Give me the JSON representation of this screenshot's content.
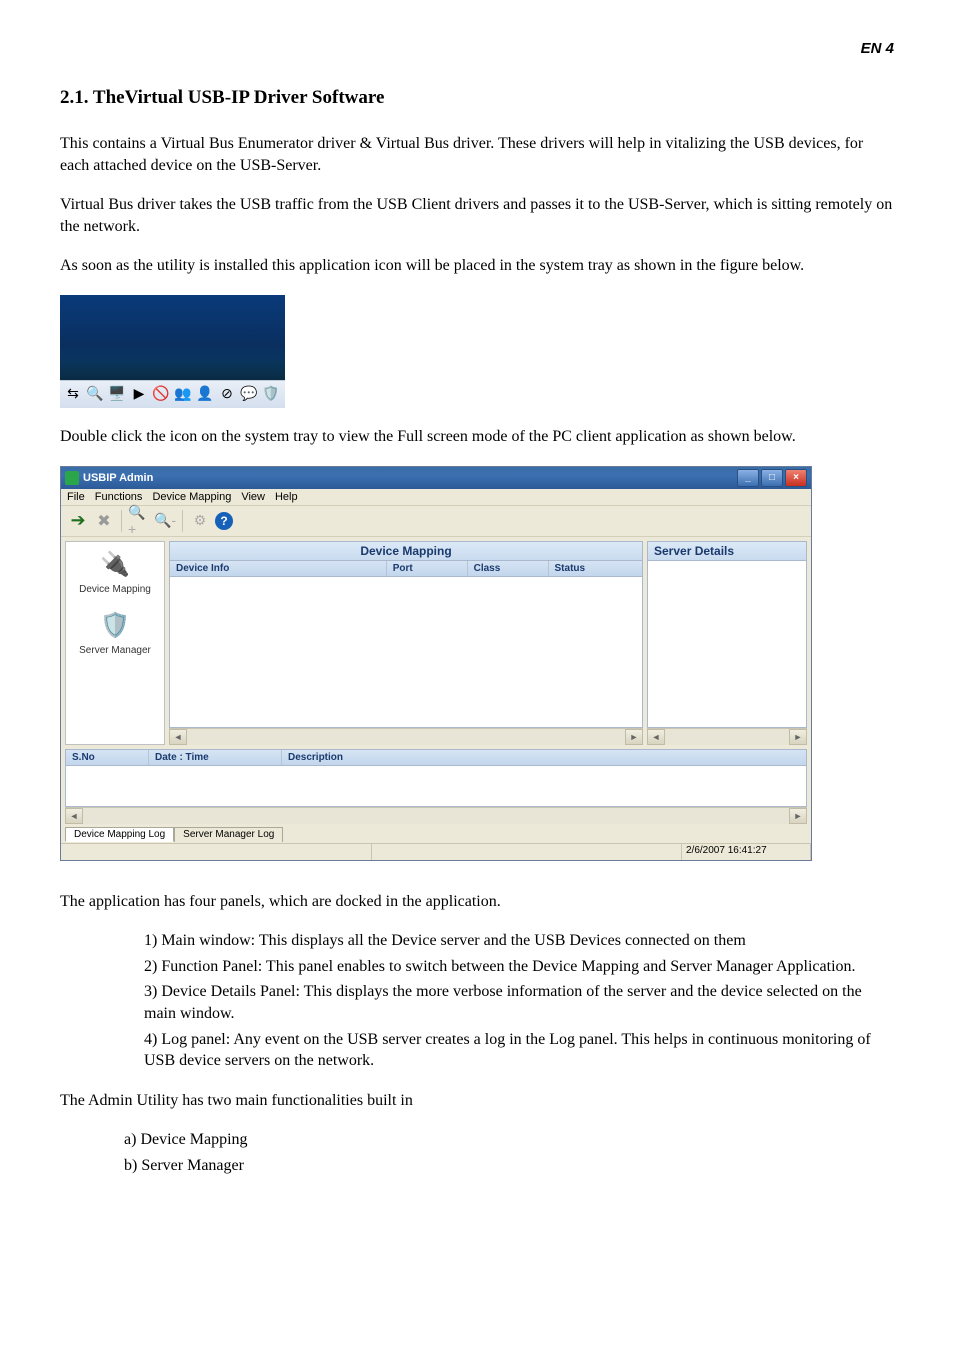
{
  "page_header": "EN 4",
  "heading": "2.1. TheVirtual USB-IP Driver Software",
  "para1": "This contains a Virtual Bus Enumerator driver & Virtual Bus driver. These drivers will help in vitalizing the USB devices, for each attached device on the USB-Server.",
  "para2": "Virtual Bus driver takes the USB traffic from the USB Client drivers and passes it to the USB-Server, which is sitting remotely on the network.",
  "para3": "As soon as the utility is installed this application icon will be placed in the system tray as shown in the figure below.",
  "para4": "Double click the icon on the system tray to view the Full screen mode of the PC client application as shown below.",
  "para5": "The application has four panels, which are docked in the application.",
  "panels_list": [
    "Main window: This displays all the Device server and the USB Devices connected on them",
    "Function Panel: This panel enables to switch between the Device Mapping and Server Manager Application.",
    "Device Details Panel: This displays the more verbose information of the server and the device selected on the main window.",
    "Log panel: Any event on the USB server creates a log in the Log panel. This helps in continuous monitoring of USB device servers on the network."
  ],
  "para6": "The Admin Utility has two main functionalities built in",
  "func_list": [
    "Device Mapping",
    "Server Manager"
  ],
  "appwin": {
    "title": "USBIP Admin",
    "menu": [
      "File",
      "Functions",
      "Device Mapping",
      "View",
      "Help"
    ],
    "toolbar": {
      "help": "?"
    },
    "func_panel": {
      "items": [
        {
          "label": "Device Mapping",
          "icon": "🔌"
        },
        {
          "label": "Server Manager",
          "icon": "🛡️"
        }
      ]
    },
    "device_mapping": {
      "title": "Device Mapping",
      "cols": [
        "Device Info",
        "Port",
        "Class",
        "Status"
      ]
    },
    "server_details": {
      "title": "Server Details"
    },
    "log": {
      "cols": [
        "S.No",
        "Date : Time",
        "Description"
      ],
      "tabs": [
        "Device Mapping Log",
        "Server Manager Log"
      ]
    },
    "status_ts": "2/6/2007 16:41:27"
  }
}
